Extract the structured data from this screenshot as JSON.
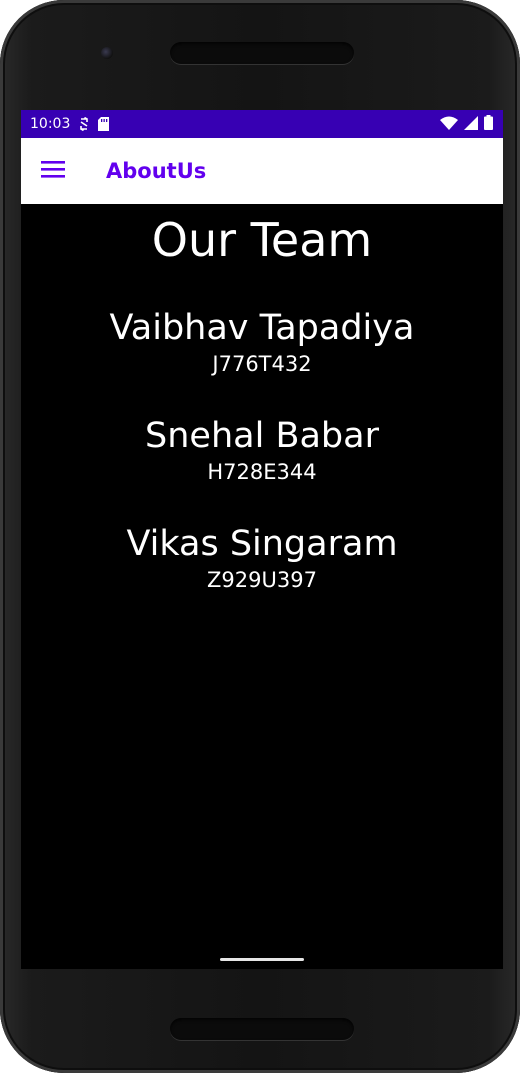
{
  "status_bar": {
    "time": "10:03",
    "color": "#3700b3"
  },
  "app_bar": {
    "title": "AboutUs",
    "menu_icon": "hamburger-menu-icon",
    "accent": "#6200ee"
  },
  "page": {
    "heading": "Our Team",
    "members": [
      {
        "name": "Vaibhav Tapadiya",
        "id": "J776T432"
      },
      {
        "name": "Snehal Babar",
        "id": "H728E344"
      },
      {
        "name": "Vikas Singaram",
        "id": "Z929U397"
      }
    ]
  }
}
